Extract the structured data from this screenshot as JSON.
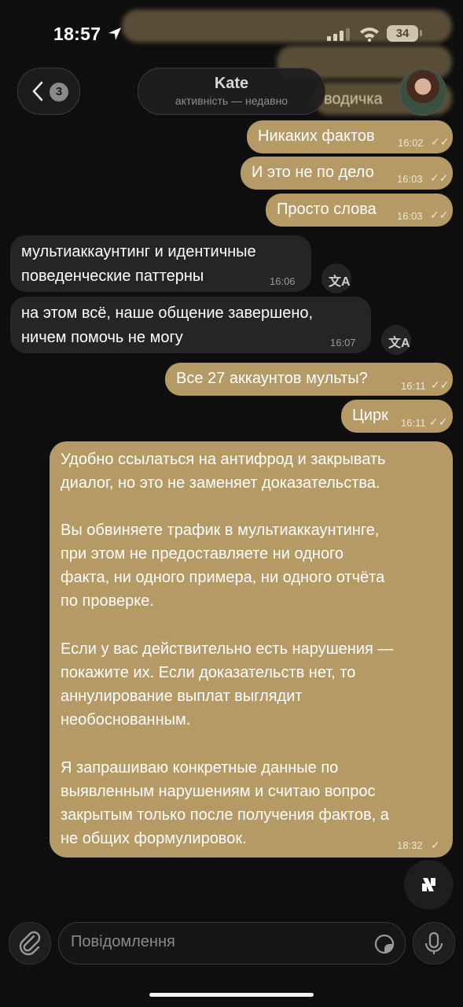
{
  "status": {
    "time": "18:57",
    "battery": "34"
  },
  "header": {
    "back_count": "3",
    "contact_name": "Kate",
    "contact_status": "активність — недавно"
  },
  "behind_header_text": "водичка",
  "messages": [
    {
      "dir": "out",
      "text": "Никаких фактов",
      "time": "16:02"
    },
    {
      "dir": "out",
      "text": "И это не по дело",
      "time": "16:03"
    },
    {
      "dir": "out",
      "text": "Просто слова",
      "time": "16:03"
    },
    {
      "dir": "in",
      "line1": "мультиаккаунтинг и идентичные",
      "line2": "поведенческие паттерны",
      "time": "16:06"
    },
    {
      "dir": "in",
      "line1": "на этом всё, наше общение завершено,",
      "line2": "ничем помочь не могу",
      "time": "16:07"
    },
    {
      "dir": "out",
      "text": "Все 27 аккаунтов мульты?",
      "time": "16:11"
    },
    {
      "dir": "out",
      "text": "Цирк",
      "time": "16:11"
    },
    {
      "dir": "out",
      "paragraphs": [
        [
          "Удобно ссылаться на антифрод и закрывать",
          "диалог, но это не заменяет доказательства."
        ],
        [
          "Вы обвиняете трафик в мультиаккаунтинге,",
          "при этом не предоставляете ни одного",
          "факта, ни одного примера, ни одного отчёта",
          "по проверке."
        ],
        [
          "Если у вас действительно есть нарушения —",
          "покажите их. Если доказательств нет, то",
          "аннулирование выплат выглядит",
          "необоснованным."
        ],
        [
          "Я запрашиваю конкретные данные по",
          "выявленным нарушениям и считаю вопрос",
          "закрытым только после получения фактов, а",
          "не общих формулировок."
        ]
      ],
      "time": "18:32"
    }
  ],
  "input": {
    "placeholder": "Повідомлення"
  },
  "colors": {
    "outgoing_bubble": "#b59a66",
    "incoming_bubble": "#252525",
    "background": "#0e0e0e"
  }
}
